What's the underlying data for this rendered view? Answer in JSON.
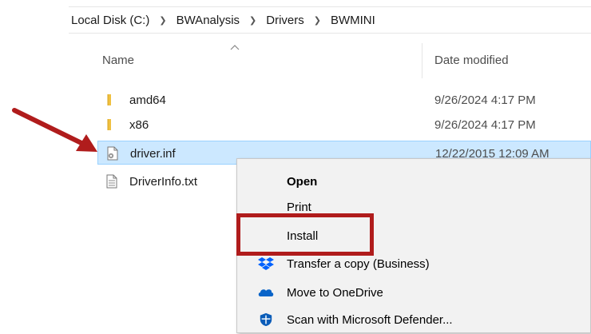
{
  "breadcrumb": [
    "Local Disk (C:)",
    "BWAnalysis",
    "Drivers",
    "BWMINI"
  ],
  "columns": {
    "name": "Name",
    "date_modified": "Date modified"
  },
  "files": [
    {
      "name": "amd64",
      "date": "9/26/2024 4:17 PM",
      "type": "folder"
    },
    {
      "name": "x86",
      "date": "9/26/2024 4:17 PM",
      "type": "folder"
    },
    {
      "name": "driver.inf",
      "date": "12/22/2015 12:09 AM",
      "type": "inf",
      "selected": true
    },
    {
      "name": "DriverInfo.txt",
      "date": "",
      "type": "txt"
    }
  ],
  "context_menu": {
    "open": "Open",
    "print": "Print",
    "install": "Install",
    "transfer": "Transfer a copy (Business)",
    "onedrive": "Move to OneDrive",
    "defender": "Scan with Microsoft Defender..."
  },
  "colors": {
    "selection_bg": "#cce8ff",
    "selection_border": "#99d1ff",
    "annotation_red": "#b01c1c",
    "folder_yellow": "#f0c040",
    "dropbox_blue": "#0061fe",
    "onedrive_blue": "#0a64c8"
  }
}
